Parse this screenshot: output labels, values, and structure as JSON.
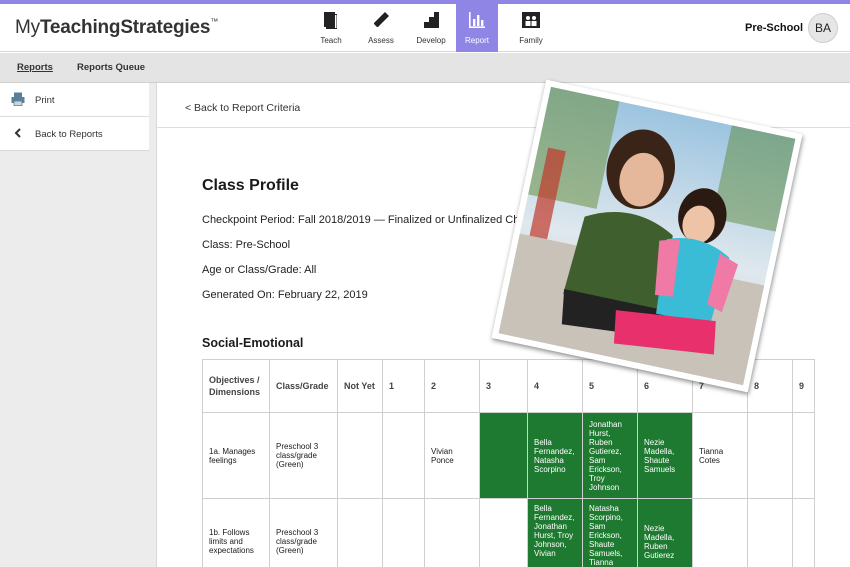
{
  "header": {
    "logo_prefix": "My",
    "logo_main": "TeachingStrategies",
    "logo_tm": "™",
    "nav": [
      {
        "label": "Teach",
        "icon": "book-icon",
        "active": false
      },
      {
        "label": "Assess",
        "icon": "pencil-icon",
        "active": false
      },
      {
        "label": "Develop",
        "icon": "stairs-icon",
        "active": false
      },
      {
        "label": "Report",
        "icon": "bar-chart-icon",
        "active": true
      },
      {
        "label": "Family",
        "icon": "family-picture-icon",
        "active": false
      }
    ],
    "school": "Pre-School",
    "avatar": "BA"
  },
  "subnav": {
    "reports": "Reports",
    "queue": "Reports Queue"
  },
  "sidebar": {
    "print": "Print",
    "back": "Back to Reports"
  },
  "main": {
    "back_link": "< Back to Report Criteria",
    "title": "Class Profile",
    "checkpoint": "Checkpoint Period: Fall 2018/2019 — Finalized or Unfinalized Checkpo",
    "class": "Class: Pre-School",
    "age": "Age or Class/Grade: All",
    "generated": "Generated On: February 22, 2019",
    "section": "Social-Emotional"
  },
  "table": {
    "headers": [
      "Objectives / Dimensions",
      "Class/Grade",
      "Not Yet",
      "1",
      "2",
      "3",
      "4",
      "5",
      "6",
      "7",
      "8",
      "9"
    ],
    "rows": [
      {
        "cells": [
          "1a. Manages feelings",
          "Preschool 3 class/grade (Green)",
          "",
          "",
          "Vivian Ponce",
          "",
          "Bella Fernandez, Natasha Scorpino",
          "Jonathan Hurst, Ruben Gutierez, Sam Erickson, Troy Johnson",
          "Nezie Madella, Shaute Samuels",
          "Tianna Cotes",
          "",
          ""
        ],
        "green": [
          5,
          6,
          7,
          8
        ]
      },
      {
        "cells": [
          "1b. Follows limits and expectations",
          "Preschool 3 class/grade (Green)",
          "",
          "",
          "",
          "",
          "Bella Fernandez, Jonathan Hurst, Troy Johnson, Vivian",
          "Natasha Scorpino, Sam Erickson, Shaute Samuels, Tianna",
          "Nezie Madella, Ruben Gutierez",
          "",
          "",
          ""
        ],
        "green": [
          6,
          7,
          8
        ]
      }
    ]
  },
  "colors": {
    "accent": "#8e85e4",
    "green_cell": "#1f7a31"
  }
}
